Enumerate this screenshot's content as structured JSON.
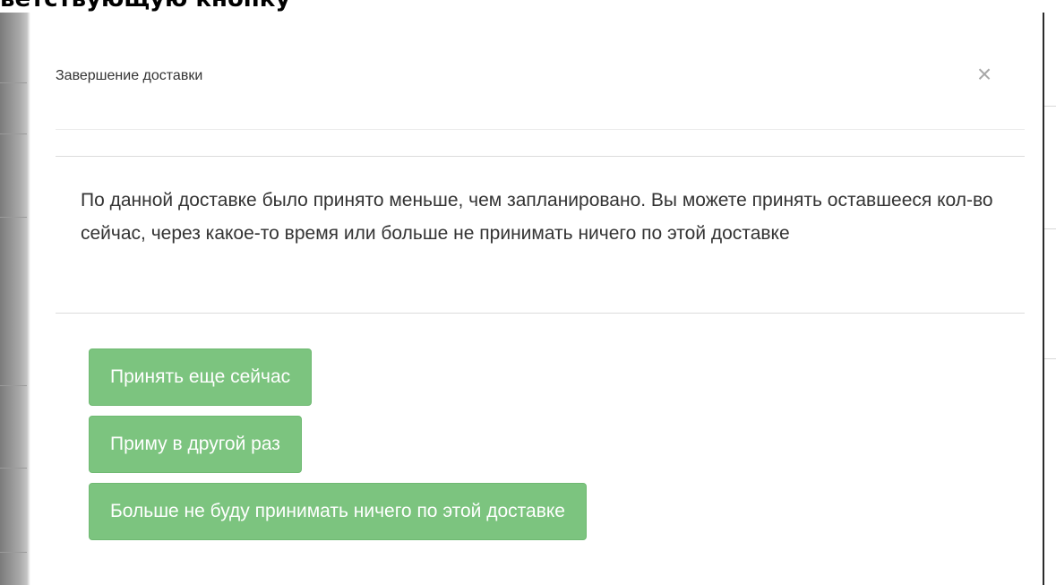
{
  "overlay": {
    "caption": "ветствующую кнопку"
  },
  "modal": {
    "title": "Завершение доставки",
    "close_symbol": "×",
    "message": "По данной доставке было принято меньше, чем запланировано. Вы можете принять оставшееся кол-во сейчас, через какое-то время или больше не принимать ничего по этой доставке",
    "buttons": [
      {
        "label": "Принять еще сейчас"
      },
      {
        "label": "Приму в другой раз"
      },
      {
        "label": "Больше не буду принимать ничего по этой доставке"
      }
    ]
  },
  "colors": {
    "button_bg": "#7cc47f",
    "button_text": "#ffffff",
    "text": "#333333",
    "close_icon": "#a8a8a8"
  },
  "icons": {
    "close": "close-icon"
  }
}
